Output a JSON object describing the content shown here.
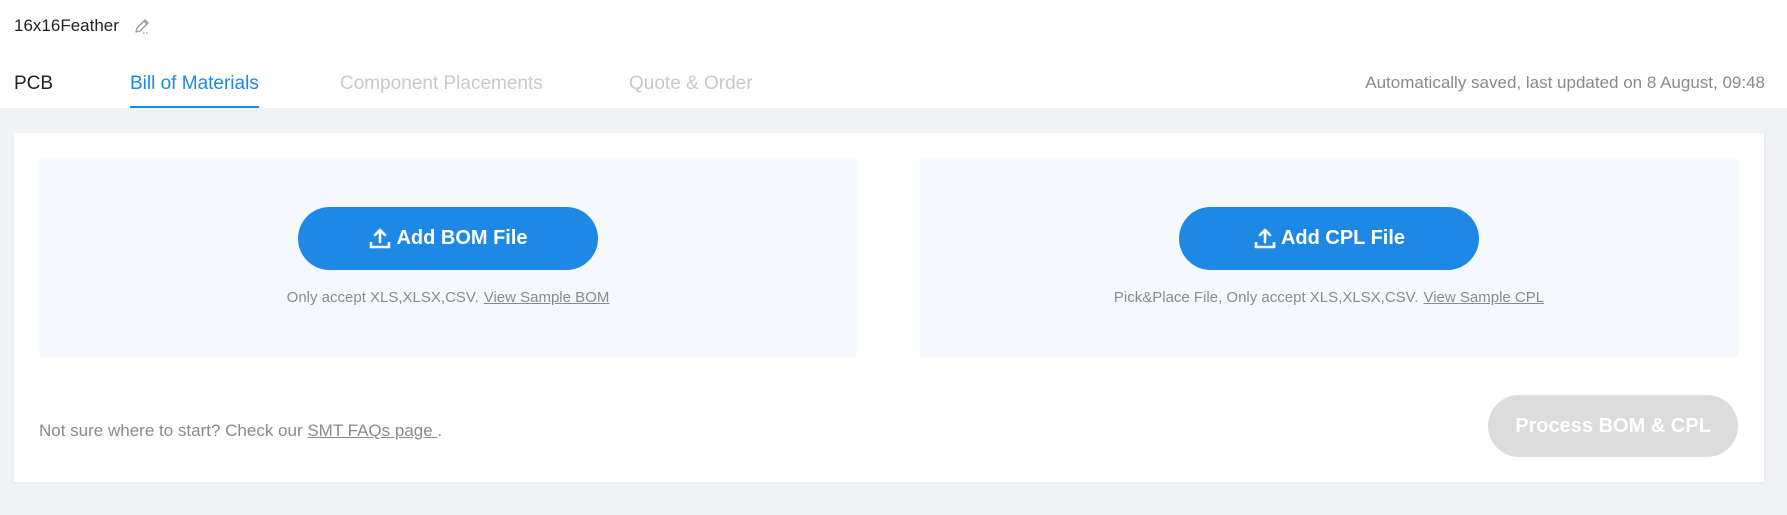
{
  "project": {
    "name": "16x16Feather",
    "edit_icon": "pencil-icon"
  },
  "tabs": [
    {
      "label": "PCB",
      "state": "normal"
    },
    {
      "label": "Bill of Materials",
      "state": "active"
    },
    {
      "label": "Component Placements",
      "state": "disabled"
    },
    {
      "label": "Quote & Order",
      "state": "disabled"
    }
  ],
  "status": {
    "saved_text": "Automatically saved, last updated on 8 August, 09:48"
  },
  "bom_upload": {
    "button_label": "Add BOM File",
    "icon": "upload-icon",
    "hint": "Only accept XLS,XLSX,CSV.",
    "sample_link": "View Sample BOM"
  },
  "cpl_upload": {
    "button_label": "Add CPL File",
    "icon": "upload-icon",
    "hint": "Pick&Place File, Only accept XLS,XLSX,CSV.",
    "sample_link": "View Sample CPL"
  },
  "footer": {
    "prefix": "Not sure where to start? Check our ",
    "faq_link": "SMT FAQs page ",
    "suffix": ".",
    "process_button": "Process BOM & CPL"
  },
  "colors": {
    "accent": "#1e88e5",
    "disabled_tab": "#c9c9c9",
    "disabled_button": "#dcdcdc",
    "page_background": "#f0f2f5",
    "dropzone_background": "#f5f9fe"
  }
}
